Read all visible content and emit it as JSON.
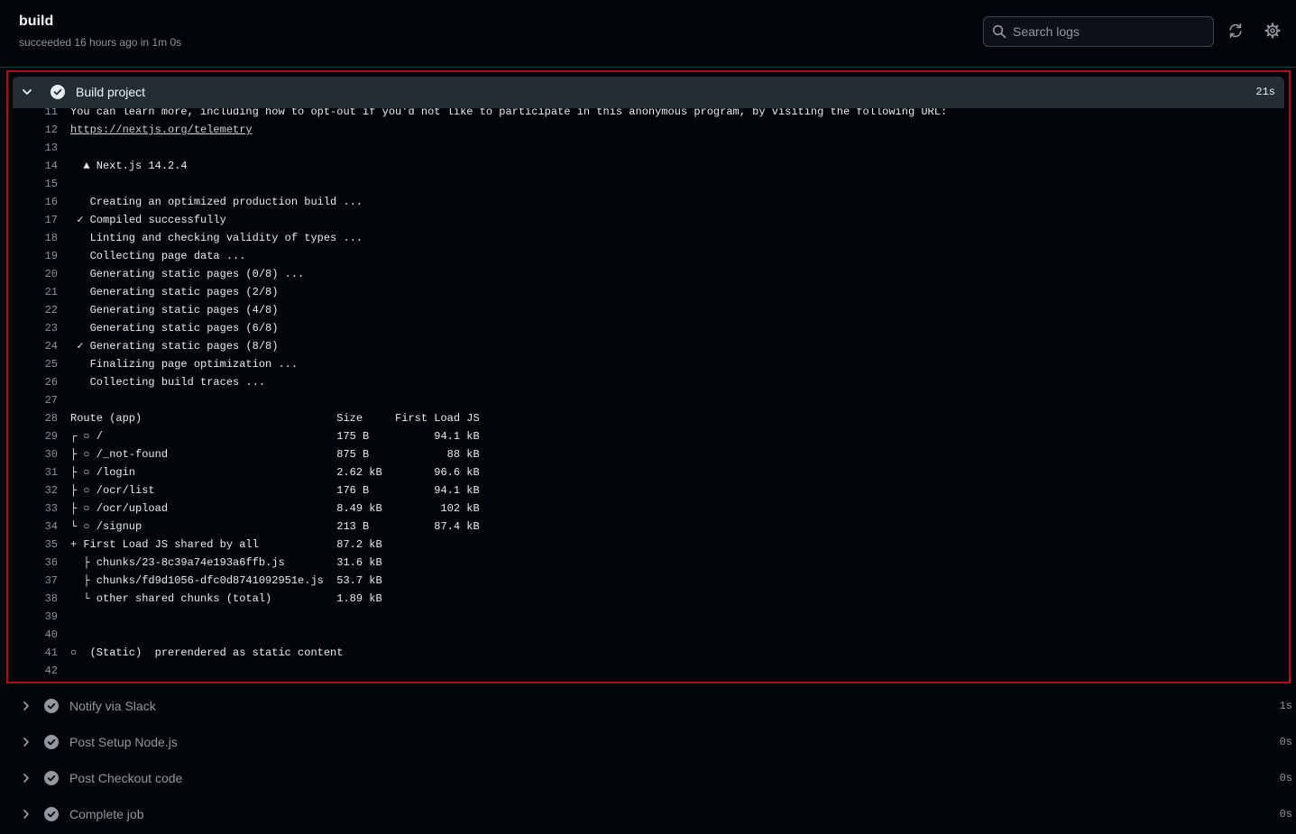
{
  "header": {
    "title": "build",
    "subtitle": "succeeded 16 hours ago in 1m 0s",
    "search_placeholder": "Search logs"
  },
  "icons": {
    "search": "search-icon",
    "refresh": "refresh-icon",
    "settings": "gear-icon",
    "expand": "chevron-down-icon",
    "collapse": "chevron-right-icon",
    "status": "check-circle-icon"
  },
  "colors": {
    "accent_border": "#b00d16",
    "success_check": "#8b949e"
  },
  "expanded_step": {
    "name": "Build project",
    "duration": "21s",
    "log_lines": [
      {
        "n": "11",
        "text": "You can learn more, including how to opt-out if you'd not like to participate in this anonymous program, by visiting the following URL:"
      },
      {
        "n": "12",
        "text": "https://nextjs.org/telemetry",
        "link": true
      },
      {
        "n": "13",
        "text": ""
      },
      {
        "n": "14",
        "text": "  ▲ Next.js 14.2.4"
      },
      {
        "n": "15",
        "text": ""
      },
      {
        "n": "16",
        "text": "   Creating an optimized production build ..."
      },
      {
        "n": "17",
        "text": " ✓ Compiled successfully"
      },
      {
        "n": "18",
        "text": "   Linting and checking validity of types ..."
      },
      {
        "n": "19",
        "text": "   Collecting page data ..."
      },
      {
        "n": "20",
        "text": "   Generating static pages (0/8) ..."
      },
      {
        "n": "21",
        "text": "   Generating static pages (2/8)"
      },
      {
        "n": "22",
        "text": "   Generating static pages (4/8)"
      },
      {
        "n": "23",
        "text": "   Generating static pages (6/8)"
      },
      {
        "n": "24",
        "text": " ✓ Generating static pages (8/8)"
      },
      {
        "n": "25",
        "text": "   Finalizing page optimization ..."
      },
      {
        "n": "26",
        "text": "   Collecting build traces ..."
      },
      {
        "n": "27",
        "text": ""
      },
      {
        "n": "28",
        "text": "Route (app)                              Size     First Load JS"
      },
      {
        "n": "29",
        "text": "┌ ○ /                                    175 B          94.1 kB"
      },
      {
        "n": "30",
        "text": "├ ○ /_not-found                          875 B            88 kB"
      },
      {
        "n": "31",
        "text": "├ ○ /login                               2.62 kB        96.6 kB"
      },
      {
        "n": "32",
        "text": "├ ○ /ocr/list                            176 B          94.1 kB"
      },
      {
        "n": "33",
        "text": "├ ○ /ocr/upload                          8.49 kB         102 kB"
      },
      {
        "n": "34",
        "text": "└ ○ /signup                              213 B          87.4 kB"
      },
      {
        "n": "35",
        "text": "+ First Load JS shared by all            87.2 kB"
      },
      {
        "n": "36",
        "text": "  ├ chunks/23-8c39a74e193a6ffb.js        31.6 kB"
      },
      {
        "n": "37",
        "text": "  ├ chunks/fd9d1056-dfc0d8741092951e.js  53.7 kB"
      },
      {
        "n": "38",
        "text": "  └ other shared chunks (total)          1.89 kB"
      },
      {
        "n": "39",
        "text": ""
      },
      {
        "n": "40",
        "text": ""
      },
      {
        "n": "41",
        "text": "○  (Static)  prerendered as static content"
      },
      {
        "n": "42",
        "text": ""
      }
    ]
  },
  "collapsed_steps": [
    {
      "name": "Notify via Slack",
      "duration": "1s"
    },
    {
      "name": "Post Setup Node.js",
      "duration": "0s"
    },
    {
      "name": "Post Checkout code",
      "duration": "0s"
    },
    {
      "name": "Complete job",
      "duration": "0s"
    }
  ]
}
